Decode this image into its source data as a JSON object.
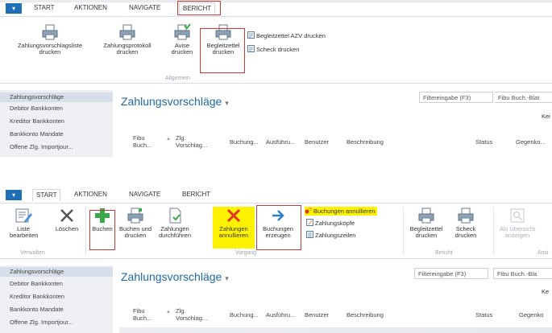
{
  "colors": {
    "accent": "#1e6fb8",
    "highlight": "#fff200",
    "box": "#d0383a",
    "title": "#1f6aa5"
  },
  "panel1": {
    "tabs": [
      "START",
      "AKTIONEN",
      "NAVIGATE",
      "BERICHT"
    ],
    "buttons": {
      "zahlungsvorschlagsliste": [
        "Zahlungsvorschlagsliste",
        "drucken"
      ],
      "zahlungsprotokoll": [
        "Zahlungsprotokoll",
        "drucken"
      ],
      "avise": [
        "Avise",
        "drucken"
      ],
      "begleitzettel": [
        "Begleitzettel",
        "drucken"
      ],
      "begleitzettel_azv": "Begleitzettel AZV drucken",
      "scheck": "Scheck drucken"
    },
    "group_label": "Allgemein",
    "nav": [
      "Zahlungsvorschläge",
      "Debitor Bankkonten",
      "Kreditor Bankkonten",
      "Bankkonto Mandate",
      "Offene Zlg. Importjour..."
    ],
    "title": "Zahlungsvorschläge",
    "filter": "Filtereingabe (F3)",
    "filter_field": "Fibu Buch.-Blat",
    "right_text": "Kei",
    "columns": {
      "fibu": [
        "Fibu",
        "Buch..."
      ],
      "zlg": [
        "Zlg.",
        "Vorschlag..."
      ],
      "buchung": "Buchung...",
      "ausfuehrung": "Ausführu...",
      "benutzer": "Benutzer",
      "beschreibung": "Beschreibung",
      "status": "Status",
      "gegenko": "Gegenko..."
    }
  },
  "panel2": {
    "tabs": [
      "START",
      "AKTIONEN",
      "NAVIGATE",
      "BERICHT"
    ],
    "buttons": {
      "liste": [
        "Liste",
        "bearbeiten"
      ],
      "loeschen": "Löschen",
      "buchen": "Buchen",
      "buchen_drucken": [
        "Buchen und",
        "drucken"
      ],
      "zahlungen_durchfuehren": [
        "Zahlungen",
        "durchführen"
      ],
      "zahlungen_annullieren": [
        "Zahlungen",
        "annullieren"
      ],
      "buchungen_erzeugen": [
        "Buchungen",
        "erzeugen"
      ],
      "buchungen_annullieren": "Buchungen annullieren",
      "zahlungskoepfe": "Zahlungsköpfe",
      "zahlungszeilen": "Zahlungszeilen",
      "begleitzettel": [
        "Begleitzettel",
        "drucken"
      ],
      "scheck": [
        "Scheck",
        "drucken"
      ],
      "als_uebersicht": [
        "Als Übersicht",
        "anzeigen"
      ]
    },
    "groups": {
      "verwalten": "Verwalten",
      "vorgang": "Vorgang",
      "bericht": "Bericht",
      "ansicht": "Ansi"
    },
    "nav": [
      "Zahlungsvorschläge",
      "Debitor Bankkonten",
      "Kreditor Bankkonten",
      "Bankkonto Mandate",
      "Offene Zlg. Importjour..."
    ],
    "title": "Zahlungsvorschläge",
    "filter": "Filtereingabe (F3)",
    "filter_field": "Fibu Buch.-Bla",
    "right_text": "Ke",
    "columns": {
      "fibu": [
        "Fibu",
        "Buch..."
      ],
      "zlg": [
        "Zlg.",
        "Vorschlag..."
      ],
      "buchung": "Buchung...",
      "ausfuehrung": "Ausführu...",
      "benutzer": "Benutzer",
      "beschreibung": "Beschreibung",
      "status": "Status",
      "gegenko": "Gegenko"
    }
  }
}
